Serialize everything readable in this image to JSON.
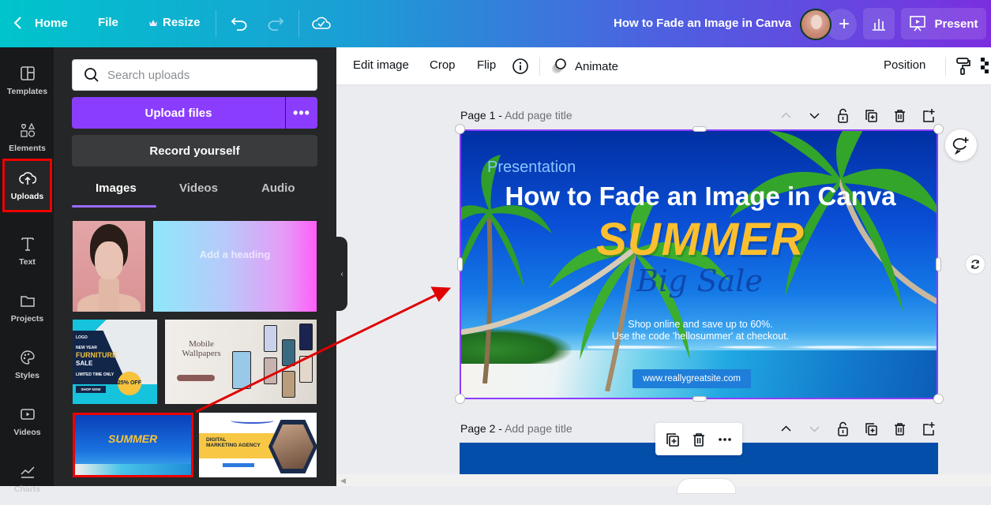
{
  "topbar": {
    "home_label": "Home",
    "file_label": "File",
    "resize_label": "Resize",
    "doc_title": "How to Fade an Image in Canva",
    "present_label": "Present"
  },
  "leftnav": {
    "items": [
      {
        "label": "Templates",
        "icon": "templates-icon"
      },
      {
        "label": "Elements",
        "icon": "elements-icon"
      },
      {
        "label": "Uploads",
        "icon": "upload-cloud-icon",
        "active": true
      },
      {
        "label": "Text",
        "icon": "text-icon"
      },
      {
        "label": "Projects",
        "icon": "folder-icon"
      },
      {
        "label": "Styles",
        "icon": "palette-icon"
      },
      {
        "label": "Videos",
        "icon": "video-icon"
      },
      {
        "label": "Charts",
        "icon": "chart-icon"
      }
    ]
  },
  "uploads_panel": {
    "search_placeholder": "Search uploads",
    "upload_label": "Upload files",
    "more_label": "•••",
    "record_label": "Record yourself",
    "tabs": [
      {
        "label": "Images",
        "active": true
      },
      {
        "label": "Videos"
      },
      {
        "label": "Audio"
      }
    ],
    "thumbnails": {
      "heading_text": "Add a heading",
      "furniture": {
        "logo": "LOGO",
        "line1": "NEW YEAR",
        "line2": "FURNITURE",
        "line3": "SALE",
        "line4": "LIMITED TIME ONLY",
        "badge": "25% OFF",
        "cta": "SHOP NOW"
      },
      "wallpapers": {
        "title": "Mobile Wallpapers"
      },
      "summer": {
        "title": "SUMMER"
      },
      "digital": {
        "line1": "DIGITAL",
        "line2": "MARKETING AGENCY"
      }
    }
  },
  "context_toolbar": {
    "edit_image": "Edit image",
    "crop": "Crop",
    "flip": "Flip",
    "animate": "Animate",
    "position": "Position"
  },
  "pages": [
    {
      "label": "Page 1 -",
      "title_placeholder": "Add page title"
    },
    {
      "label": "Page 2 -",
      "title_placeholder": "Add page title"
    }
  ],
  "canvas": {
    "presentation": "Presentation",
    "title": "How to Fade an Image in Canva",
    "summer": "SUMMER",
    "big_sale": "Big Sale",
    "body_line1": "Shop online and save up to 60%.",
    "body_line2": "Use the code 'hellosummer' at checkout.",
    "url": "www.reallygreatsite.com"
  },
  "colors": {
    "accent_purple": "#8b3dff",
    "highlight_red": "#e00000",
    "summer_yellow": "#fcbf2f"
  }
}
